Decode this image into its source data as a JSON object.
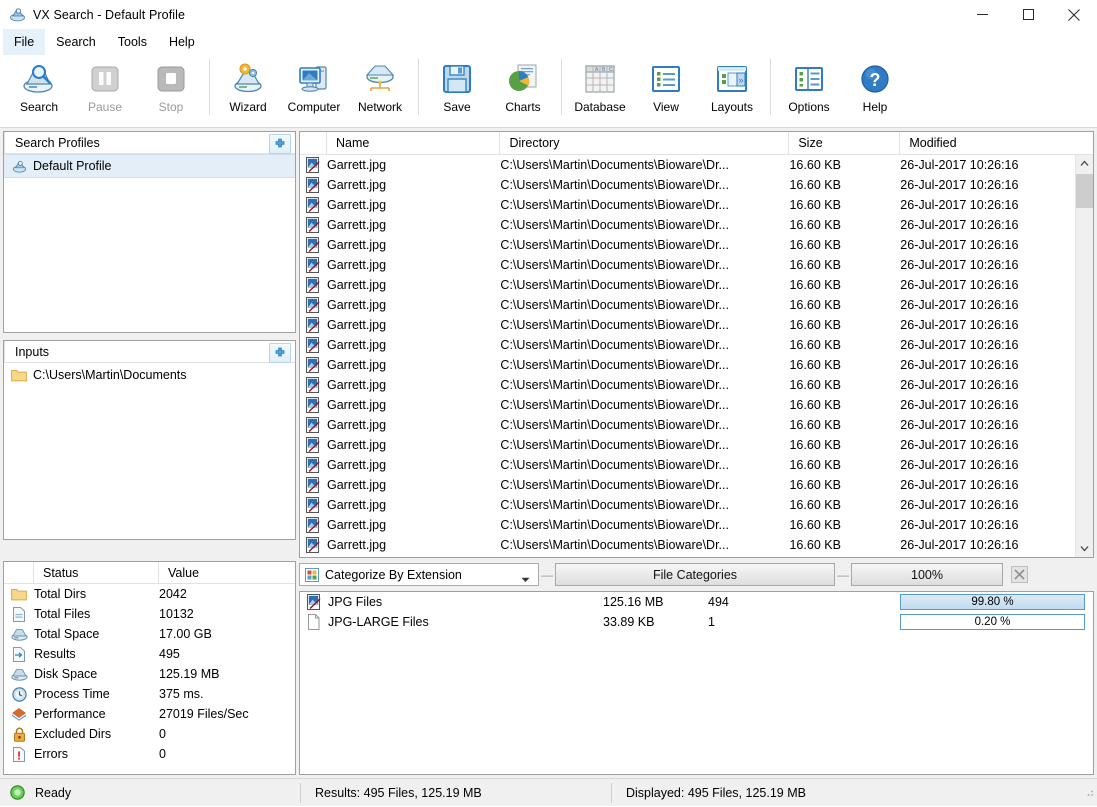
{
  "window": {
    "title": "VX Search - Default Profile",
    "icon": "vx-search-icon",
    "controls": {
      "minimize": "minimize-icon",
      "maximize": "maximize-icon",
      "close": "close-icon"
    }
  },
  "menu": {
    "items": [
      {
        "label": "File",
        "active": true
      },
      {
        "label": "Search",
        "active": false
      },
      {
        "label": "Tools",
        "active": false
      },
      {
        "label": "Help",
        "active": false
      }
    ]
  },
  "toolbar": {
    "buttons": [
      {
        "label": "Search",
        "icon": "search-disk-icon",
        "disabled": false
      },
      {
        "label": "Pause",
        "icon": "pause-icon",
        "disabled": true
      },
      {
        "label": "Stop",
        "icon": "stop-icon",
        "disabled": true
      },
      {
        "label": "Wizard",
        "icon": "wizard-icon",
        "disabled": false
      },
      {
        "label": "Computer",
        "icon": "computer-icon",
        "disabled": false
      },
      {
        "label": "Network",
        "icon": "network-icon",
        "disabled": false
      },
      {
        "label": "Save",
        "icon": "floppy-save-icon",
        "disabled": false
      },
      {
        "label": "Charts",
        "icon": "pie-chart-icon",
        "disabled": false
      },
      {
        "label": "Database",
        "icon": "database-grid-icon",
        "disabled": false
      },
      {
        "label": "View",
        "icon": "list-view-icon",
        "disabled": false
      },
      {
        "label": "Layouts",
        "icon": "layouts-icon",
        "disabled": false
      },
      {
        "label": "Options",
        "icon": "options-icon",
        "disabled": false
      },
      {
        "label": "Help",
        "icon": "help-question-icon",
        "disabled": false
      }
    ],
    "separator_after": [
      2,
      5,
      7,
      10
    ]
  },
  "profiles": {
    "header": "Search Profiles",
    "add_icon": "add-plus-icon",
    "items": [
      {
        "label": "Default Profile",
        "icon": "profile-icon",
        "selected": true
      }
    ]
  },
  "inputs": {
    "header": "Inputs",
    "add_icon": "add-plus-icon",
    "items": [
      {
        "label": "C:\\Users\\Martin\\Documents",
        "icon": "folder-icon"
      }
    ]
  },
  "filelist": {
    "columns": [
      {
        "key": "name",
        "label": "Name"
      },
      {
        "key": "dir",
        "label": "Directory"
      },
      {
        "key": "size",
        "label": "Size"
      },
      {
        "key": "mod",
        "label": "Modified"
      }
    ],
    "row_icon": "jpg-image-icon",
    "rows": [
      {
        "name": "Garrett.jpg",
        "dir": "C:\\Users\\Martin\\Documents\\Bioware\\Dr...",
        "size": "16.60 KB",
        "mod": "26-Jul-2017 10:26:16"
      },
      {
        "name": "Garrett.jpg",
        "dir": "C:\\Users\\Martin\\Documents\\Bioware\\Dr...",
        "size": "16.60 KB",
        "mod": "26-Jul-2017 10:26:16"
      },
      {
        "name": "Garrett.jpg",
        "dir": "C:\\Users\\Martin\\Documents\\Bioware\\Dr...",
        "size": "16.60 KB",
        "mod": "26-Jul-2017 10:26:16"
      },
      {
        "name": "Garrett.jpg",
        "dir": "C:\\Users\\Martin\\Documents\\Bioware\\Dr...",
        "size": "16.60 KB",
        "mod": "26-Jul-2017 10:26:16"
      },
      {
        "name": "Garrett.jpg",
        "dir": "C:\\Users\\Martin\\Documents\\Bioware\\Dr...",
        "size": "16.60 KB",
        "mod": "26-Jul-2017 10:26:16"
      },
      {
        "name": "Garrett.jpg",
        "dir": "C:\\Users\\Martin\\Documents\\Bioware\\Dr...",
        "size": "16.60 KB",
        "mod": "26-Jul-2017 10:26:16"
      },
      {
        "name": "Garrett.jpg",
        "dir": "C:\\Users\\Martin\\Documents\\Bioware\\Dr...",
        "size": "16.60 KB",
        "mod": "26-Jul-2017 10:26:16"
      },
      {
        "name": "Garrett.jpg",
        "dir": "C:\\Users\\Martin\\Documents\\Bioware\\Dr...",
        "size": "16.60 KB",
        "mod": "26-Jul-2017 10:26:16"
      },
      {
        "name": "Garrett.jpg",
        "dir": "C:\\Users\\Martin\\Documents\\Bioware\\Dr...",
        "size": "16.60 KB",
        "mod": "26-Jul-2017 10:26:16"
      },
      {
        "name": "Garrett.jpg",
        "dir": "C:\\Users\\Martin\\Documents\\Bioware\\Dr...",
        "size": "16.60 KB",
        "mod": "26-Jul-2017 10:26:16"
      },
      {
        "name": "Garrett.jpg",
        "dir": "C:\\Users\\Martin\\Documents\\Bioware\\Dr...",
        "size": "16.60 KB",
        "mod": "26-Jul-2017 10:26:16"
      },
      {
        "name": "Garrett.jpg",
        "dir": "C:\\Users\\Martin\\Documents\\Bioware\\Dr...",
        "size": "16.60 KB",
        "mod": "26-Jul-2017 10:26:16"
      },
      {
        "name": "Garrett.jpg",
        "dir": "C:\\Users\\Martin\\Documents\\Bioware\\Dr...",
        "size": "16.60 KB",
        "mod": "26-Jul-2017 10:26:16"
      },
      {
        "name": "Garrett.jpg",
        "dir": "C:\\Users\\Martin\\Documents\\Bioware\\Dr...",
        "size": "16.60 KB",
        "mod": "26-Jul-2017 10:26:16"
      },
      {
        "name": "Garrett.jpg",
        "dir": "C:\\Users\\Martin\\Documents\\Bioware\\Dr...",
        "size": "16.60 KB",
        "mod": "26-Jul-2017 10:26:16"
      },
      {
        "name": "Garrett.jpg",
        "dir": "C:\\Users\\Martin\\Documents\\Bioware\\Dr...",
        "size": "16.60 KB",
        "mod": "26-Jul-2017 10:26:16"
      },
      {
        "name": "Garrett.jpg",
        "dir": "C:\\Users\\Martin\\Documents\\Bioware\\Dr...",
        "size": "16.60 KB",
        "mod": "26-Jul-2017 10:26:16"
      },
      {
        "name": "Garrett.jpg",
        "dir": "C:\\Users\\Martin\\Documents\\Bioware\\Dr...",
        "size": "16.60 KB",
        "mod": "26-Jul-2017 10:26:16"
      },
      {
        "name": "Garrett.jpg",
        "dir": "C:\\Users\\Martin\\Documents\\Bioware\\Dr...",
        "size": "16.60 KB",
        "mod": "26-Jul-2017 10:26:16"
      },
      {
        "name": "Garrett.jpg",
        "dir": "C:\\Users\\Martin\\Documents\\Bioware\\Dr...",
        "size": "16.60 KB",
        "mod": "26-Jul-2017 10:26:16"
      },
      {
        "name": "Garrett.jpg",
        "dir": "C:\\Users\\Martin\\Documents\\Bioware\\Dr...",
        "size": "16.60 KB",
        "mod": "26-Jul-2017 10:26:16"
      }
    ],
    "scrollbar": {
      "up": "scroll-up-icon",
      "down": "scroll-down-icon"
    }
  },
  "status_panel": {
    "columns": [
      {
        "key": "status",
        "label": "Status"
      },
      {
        "key": "value",
        "label": "Value"
      }
    ],
    "rows": [
      {
        "icon": "folder-icon",
        "label": "Total Dirs",
        "value": "2042"
      },
      {
        "icon": "file-icon",
        "label": "Total Files",
        "value": "10132"
      },
      {
        "icon": "disk-icon",
        "label": "Total Space",
        "value": "17.00 GB"
      },
      {
        "icon": "results-icon",
        "label": "Results",
        "value": "495"
      },
      {
        "icon": "disk-icon",
        "label": "Disk Space",
        "value": "125.19 MB"
      },
      {
        "icon": "clock-icon",
        "label": "Process Time",
        "value": "375 ms."
      },
      {
        "icon": "performance-icon",
        "label": "Performance",
        "value": "27019 Files/Sec"
      },
      {
        "icon": "lock-icon",
        "label": "Excluded Dirs",
        "value": "0"
      },
      {
        "icon": "error-icon",
        "label": "Errors",
        "value": "0"
      }
    ]
  },
  "categories": {
    "toolbar": {
      "combo_label": "Categorize By Extension",
      "combo_icon": "categorize-icon",
      "combo_arrow": "chevron-down-icon",
      "file_categories_label": "File Categories",
      "zoom_label": "100%",
      "close_icon": "close-panel-icon",
      "dash": "—"
    },
    "rows": [
      {
        "icon": "jpg-image-icon",
        "name": "JPG Files",
        "size": "125.16 MB",
        "count": "494",
        "percent_label": "99.80 %",
        "percent": 99.8
      },
      {
        "icon": "blank-file-icon",
        "name": "JPG-LARGE Files",
        "size": "33.89 KB",
        "count": "1",
        "percent_label": "0.20 %",
        "percent": 0.2
      }
    ]
  },
  "statusbar": {
    "state_icon": "ready-indicator-icon",
    "state": "Ready",
    "results": "Results: 495 Files, 125.19 MB",
    "displayed": "Displayed: 495 Files, 125.19 MB"
  },
  "colors": {
    "accent": "#2f7cc4",
    "selection": "#e4eef8",
    "panel_border": "#a0a0a0",
    "chrome": "#f0f0f0",
    "ready_green": "#2aa02a"
  }
}
